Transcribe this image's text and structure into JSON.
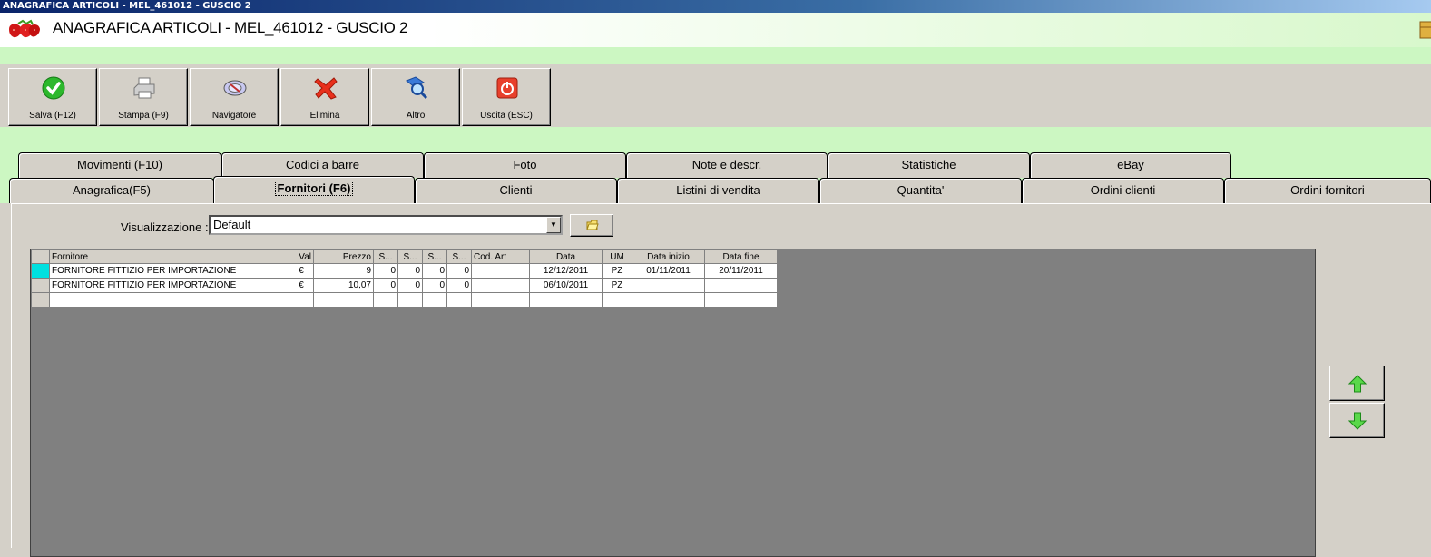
{
  "window": {
    "title": "ANAGRAFICA ARTICOLI - MEL_461012 - GUSCIO 2"
  },
  "header": {
    "title": "ANAGRAFICA ARTICOLI - MEL_461012 - GUSCIO 2"
  },
  "toolbar": {
    "buttons": [
      {
        "label": "Salva (F12)",
        "icon": "check-icon"
      },
      {
        "label": "Stampa (F9)",
        "icon": "printer-icon"
      },
      {
        "label": "Navigatore",
        "icon": "navigator-icon"
      },
      {
        "label": "Elimina",
        "icon": "delete-x-icon"
      },
      {
        "label": "Altro",
        "icon": "search-magnifier-icon"
      },
      {
        "label": "Uscita (ESC)",
        "icon": "power-icon"
      }
    ]
  },
  "tabs": {
    "row1": [
      "Movimenti (F10)",
      "Codici a barre",
      "Foto",
      "Note e descr.",
      "Statistiche",
      "eBay"
    ],
    "row2": [
      "Anagrafica(F5)",
      "Fornitori (F6)",
      "Clienti",
      "Listini di vendita",
      "Quantita'",
      "Ordini clienti",
      "Ordini fornitori"
    ],
    "active": "Fornitori (F6)"
  },
  "view": {
    "label": "Visualizzazione :",
    "value": "Default"
  },
  "grid": {
    "columns": [
      "Fornitore",
      "Val",
      "Prezzo",
      "S...",
      "S...",
      "S...",
      "S...",
      "Cod. Art",
      "Data",
      "UM",
      "Data inizio",
      "Data fine"
    ],
    "rows": [
      [
        "FORNITORE FITTIZIO PER IMPORTAZIONE",
        "€",
        "9",
        "0",
        "0",
        "0",
        "0",
        "",
        "12/12/2011",
        "PZ",
        "01/11/2011",
        "20/11/2011"
      ],
      [
        "FORNITORE FITTIZIO PER IMPORTAZIONE",
        "€",
        "10,07",
        "0",
        "0",
        "0",
        "0",
        "",
        "06/10/2011",
        "PZ",
        "",
        ""
      ],
      [
        "",
        "",
        "",
        "",
        "",
        "",
        "",
        "",
        "",
        "",
        "",
        ""
      ]
    ]
  },
  "colors": {
    "accent_green": "#ccf7c2",
    "face": "#d4d0c8",
    "grid_bg": "#808080",
    "row_indicator": "#00e0e0"
  }
}
